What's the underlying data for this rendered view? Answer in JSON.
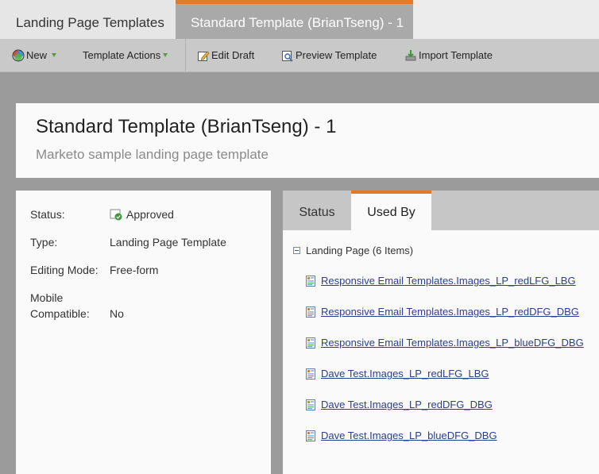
{
  "top_tabs": {
    "inactive_label": "Landing Page Templates",
    "active_label": "Standard Template (BrianTseng) - 1"
  },
  "toolbar": {
    "new_label": "New",
    "template_actions_label": "Template Actions",
    "edit_draft_label": "Edit Draft",
    "preview_template_label": "Preview Template",
    "import_template_label": "Import Template"
  },
  "header": {
    "title": "Standard Template (BrianTseng) - 1",
    "subtitle": "Marketo sample landing page template"
  },
  "details": {
    "status_label": "Status:",
    "status_value": "Approved",
    "type_label": "Type:",
    "type_value": "Landing Page Template",
    "editing_mode_label": "Editing Mode:",
    "editing_mode_value": "Free-form",
    "mobile_label_line1": "Mobile",
    "mobile_label_line2": "Compatible:",
    "mobile_value": "No"
  },
  "right_tabs": {
    "status_label": "Status",
    "used_by_label": "Used By"
  },
  "used_by": {
    "group_label": "Landing Page (6 Items)",
    "items": [
      "Responsive Email Templates.Images_LP_redLFG_LBG",
      "Responsive Email Templates.Images_LP_redDFG_DBG",
      "Responsive Email Templates.Images_LP_blueDFG_DBG",
      "Dave Test.Images_LP_redLFG_LBG",
      "Dave Test.Images_LP_redDFG_DBG",
      "Dave Test.Images_LP_blueDFG_DBG"
    ]
  },
  "colors": {
    "accent_orange": "#e27a2a",
    "link_blue": "#2b3f8f",
    "approved_green": "#3a9a3a"
  }
}
